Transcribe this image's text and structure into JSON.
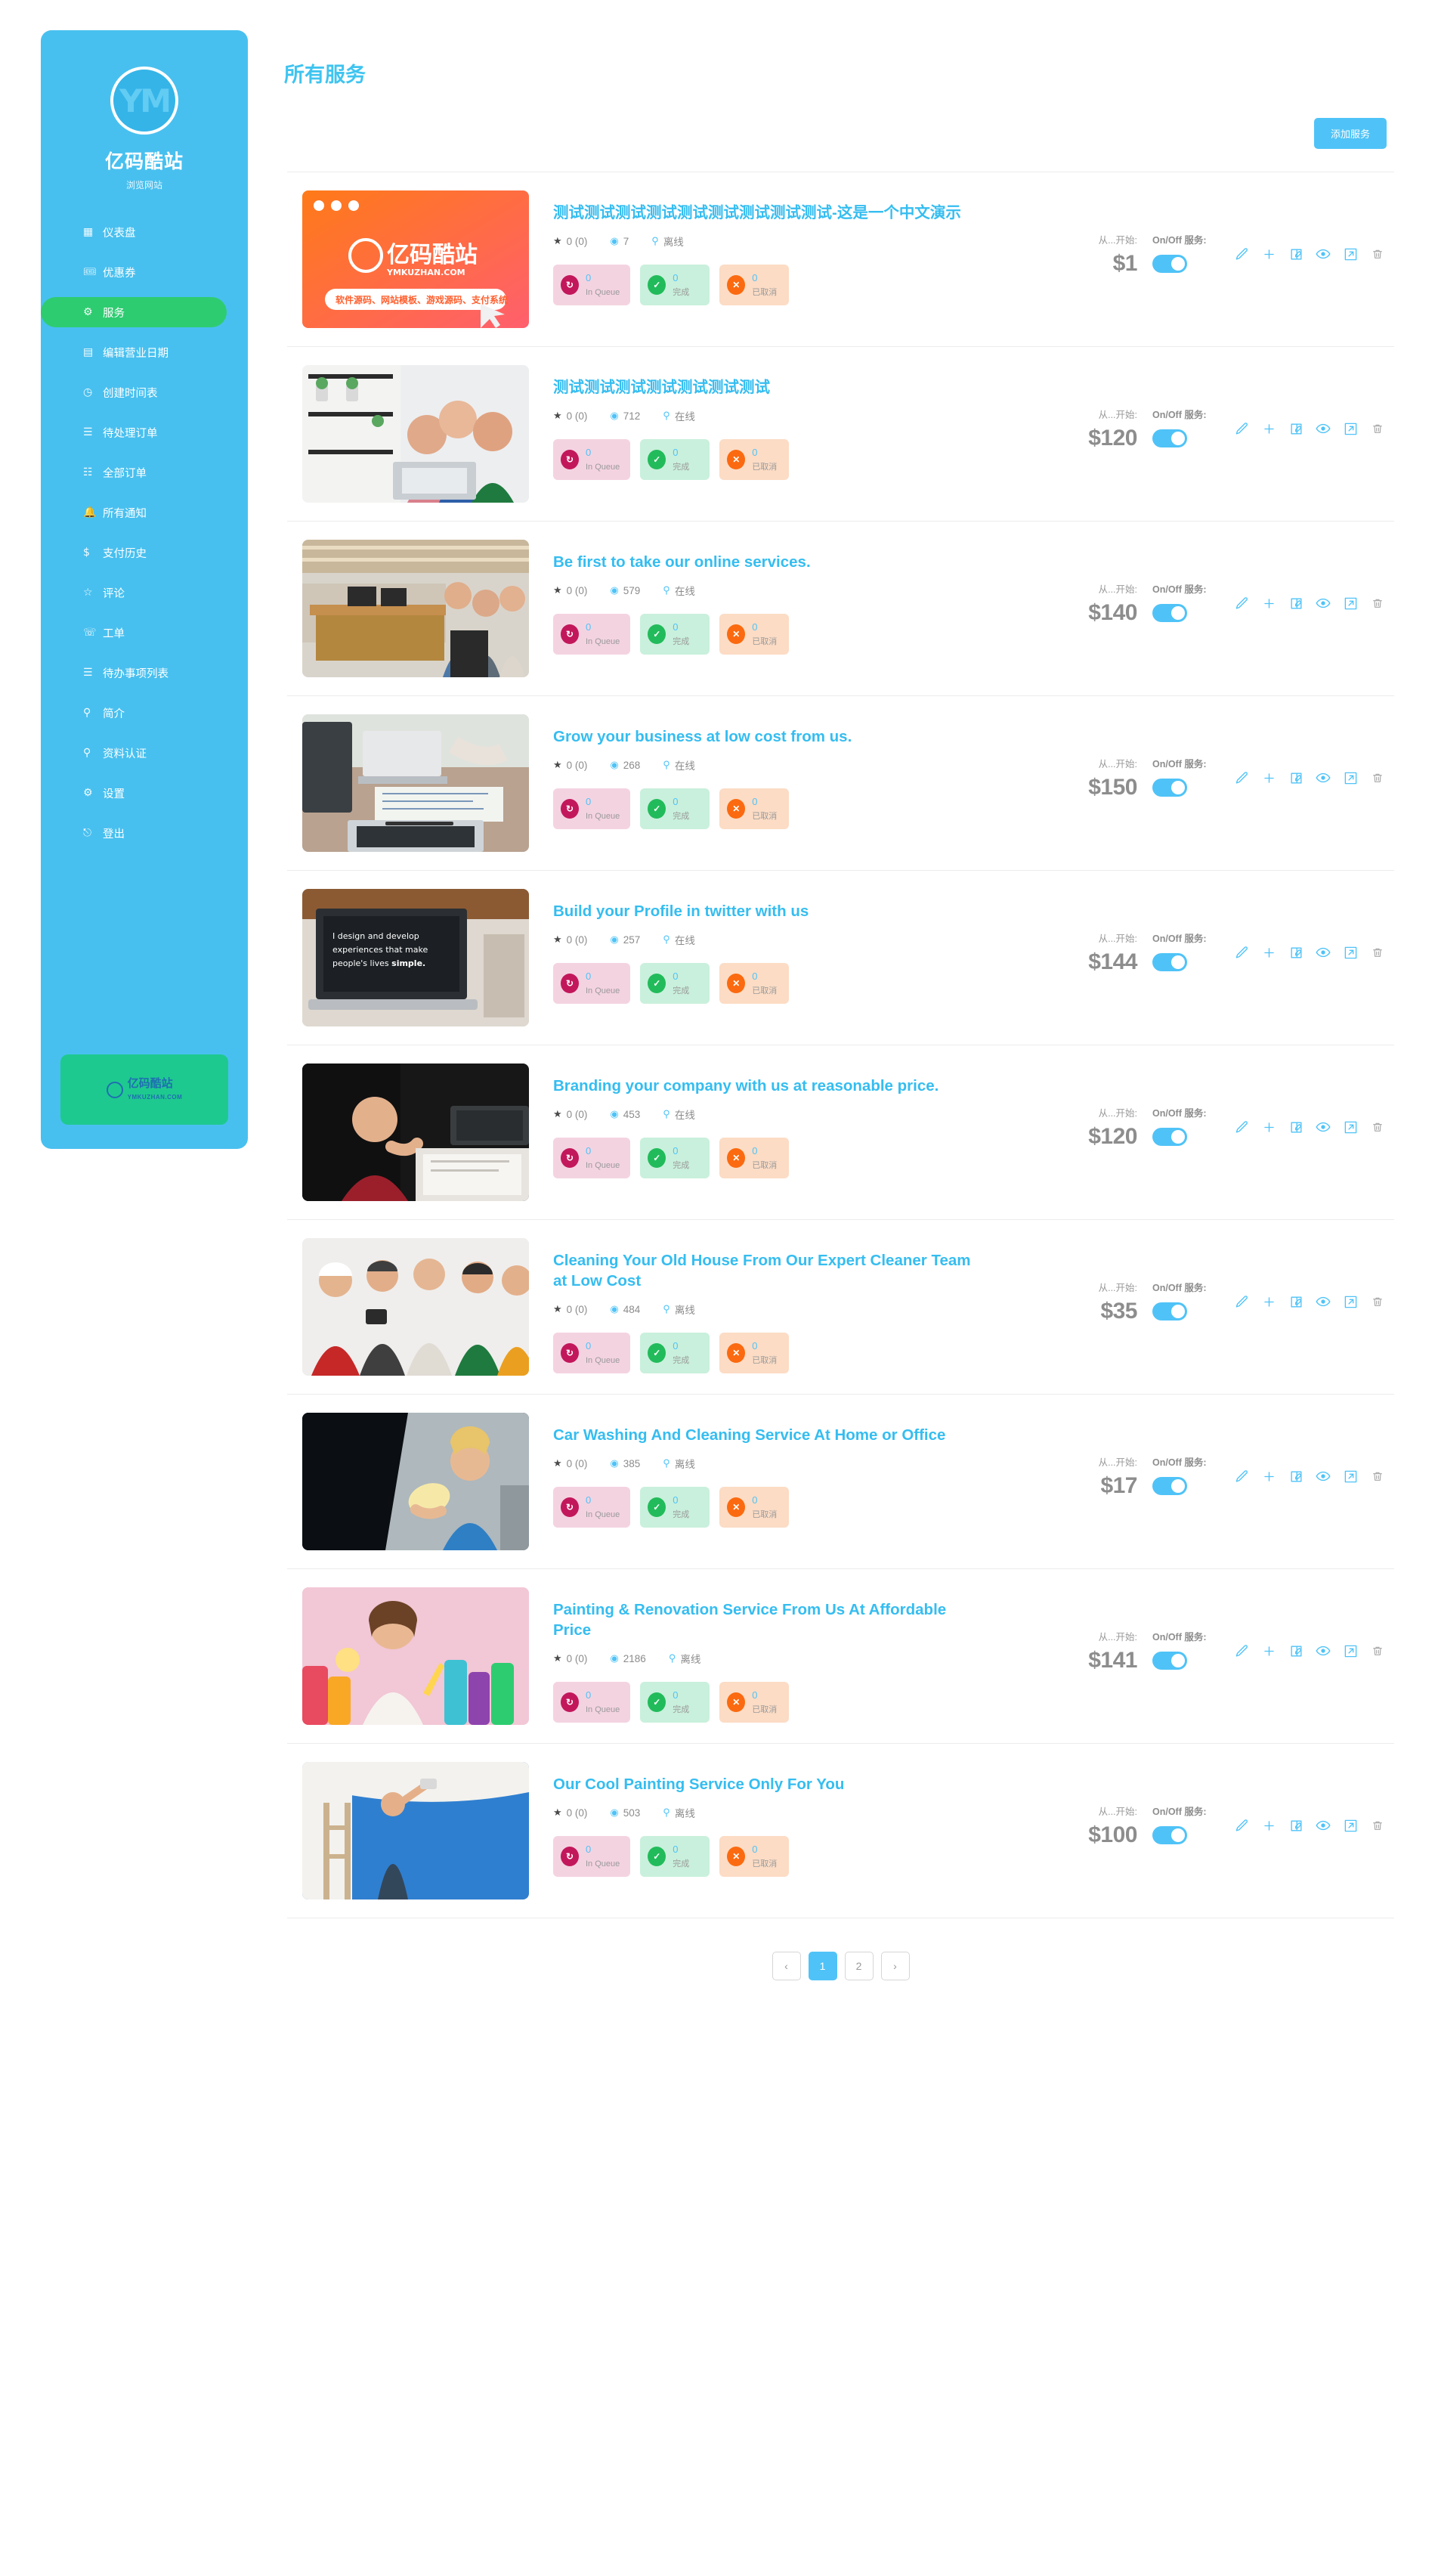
{
  "sidebar": {
    "brand": {
      "name": "亿码酷站",
      "sub": "浏览网站",
      "logo_text": "YM"
    },
    "items": [
      {
        "icon": "grid-icon",
        "glyph": "▦",
        "label": "仪表盘",
        "active": false
      },
      {
        "icon": "ticket-icon",
        "glyph": "🎟",
        "label": "优惠券",
        "active": false
      },
      {
        "icon": "services-icon",
        "glyph": "⚙",
        "label": "服务",
        "active": true
      },
      {
        "icon": "calendar-icon",
        "glyph": "▤",
        "label": "编辑营业日期",
        "active": false
      },
      {
        "icon": "clock-icon",
        "glyph": "◷",
        "label": "创建时间表",
        "active": false
      },
      {
        "icon": "pending-list-icon",
        "glyph": "☰",
        "label": "待处理订单",
        "active": false
      },
      {
        "icon": "list-icon",
        "glyph": "☷",
        "label": "全部订单",
        "active": false
      },
      {
        "icon": "bell-icon",
        "glyph": "🔔",
        "label": "所有通知",
        "active": false
      },
      {
        "icon": "dollar-icon",
        "glyph": "$",
        "label": "支付历史",
        "active": false
      },
      {
        "icon": "star-icon",
        "glyph": "☆",
        "label": "评论",
        "active": false
      },
      {
        "icon": "headset-icon",
        "glyph": "☏",
        "label": "工单",
        "active": false
      },
      {
        "icon": "todo-list-icon",
        "glyph": "☰",
        "label": "待办事项列表",
        "active": false
      },
      {
        "icon": "user-icon",
        "glyph": "⚲",
        "label": "简介",
        "active": false
      },
      {
        "icon": "id-card-icon",
        "glyph": "⚲",
        "label": "资料认证",
        "active": false
      },
      {
        "icon": "gear-icon",
        "glyph": "⚙",
        "label": "设置",
        "active": false
      },
      {
        "icon": "logout-icon",
        "glyph": "⎋",
        "label": "登出",
        "active": false
      }
    ],
    "promo": {
      "title": "亿码酷站",
      "sub": "YMKUZHAN.COM"
    }
  },
  "header": {
    "title": "所有服务",
    "add_button": "添加服务"
  },
  "labels": {
    "starting_from": "从...开始:",
    "onoff_service": "On/Off 服务:",
    "in_queue": "In Queue",
    "completed": "完成",
    "cancelled": "已取消",
    "rating_suffix": "0 (0)"
  },
  "action_icons": [
    {
      "name": "edit-pencil-icon",
      "muted": false
    },
    {
      "name": "add-plus-icon",
      "muted": false
    },
    {
      "name": "compose-icon",
      "muted": false
    },
    {
      "name": "preview-eye-icon",
      "muted": false
    },
    {
      "name": "open-external-icon",
      "muted": false
    },
    {
      "name": "delete-trash-icon",
      "muted": true
    }
  ],
  "services": [
    {
      "title": "测试测试测试测试测试测试测试测试测试-这是一个中文演示",
      "rating": "0 (0)",
      "views": "7",
      "status": "离线",
      "price": "$1",
      "in_queue": "0",
      "completed": "0",
      "cancelled": "0",
      "thumb": "ymkuzhan-orange-banner"
    },
    {
      "title": "测试测试测试测试测试测试测试",
      "rating": "0 (0)",
      "views": "712",
      "status": "在线",
      "price": "$120",
      "in_queue": "0",
      "completed": "0",
      "cancelled": "0",
      "thumb": "team-around-laptop"
    },
    {
      "title": "Be first to take our online services.",
      "rating": "0 (0)",
      "views": "579",
      "status": "在线",
      "price": "$140",
      "in_queue": "0",
      "completed": "0",
      "cancelled": "0",
      "thumb": "open-office-coworkers"
    },
    {
      "title": "Grow your business at low cost from us.",
      "rating": "0 (0)",
      "views": "268",
      "status": "在线",
      "price": "$150",
      "in_queue": "0",
      "completed": "0",
      "cancelled": "0",
      "thumb": "desk-laptop-notes"
    },
    {
      "title": "Build your Profile in twitter with us",
      "rating": "0 (0)",
      "views": "257",
      "status": "在线",
      "price": "$144",
      "in_queue": "0",
      "completed": "0",
      "cancelled": "0",
      "thumb": "laptop-design-quote"
    },
    {
      "title": "Branding your company with us at reasonable price.",
      "rating": "0 (0)",
      "views": "453",
      "status": "在线",
      "price": "$120",
      "in_queue": "0",
      "completed": "0",
      "cancelled": "0",
      "thumb": "person-clapping-desk"
    },
    {
      "title": "Cleaning Your Old House From Our Expert Cleaner Team at Low Cost",
      "rating": "0 (0)",
      "views": "484",
      "status": "离线",
      "price": "$35",
      "in_queue": "0",
      "completed": "0",
      "cancelled": "0",
      "thumb": "worker-team-group"
    },
    {
      "title": "Car Washing And Cleaning Service At Home or Office",
      "rating": "0 (0)",
      "views": "385",
      "status": "离线",
      "price": "$17",
      "in_queue": "0",
      "completed": "0",
      "cancelled": "0",
      "thumb": "car-wash-woman"
    },
    {
      "title": "Painting & Renovation Service From Us At Affordable Price",
      "rating": "0 (0)",
      "views": "2186",
      "status": "离线",
      "price": "$141",
      "in_queue": "0",
      "completed": "0",
      "cancelled": "0",
      "thumb": "cleaning-supplies-woman"
    },
    {
      "title": "Our Cool Painting Service Only For You",
      "rating": "0 (0)",
      "views": "503",
      "status": "离线",
      "price": "$100",
      "in_queue": "0",
      "completed": "0",
      "cancelled": "0",
      "thumb": "painter-blue-wall"
    }
  ],
  "pagination": {
    "prev": "‹",
    "next": "›",
    "pages": [
      "1",
      "2"
    ],
    "current": "1"
  },
  "colors": {
    "brand_blue": "#48c0ef",
    "link_blue": "#35bdf0",
    "active_green": "#2ecc71",
    "promo_green": "#1ec98f",
    "queue_pink": "#c2185b",
    "done_green": "#22bb5b",
    "cancel_orange": "#fb6a10"
  }
}
